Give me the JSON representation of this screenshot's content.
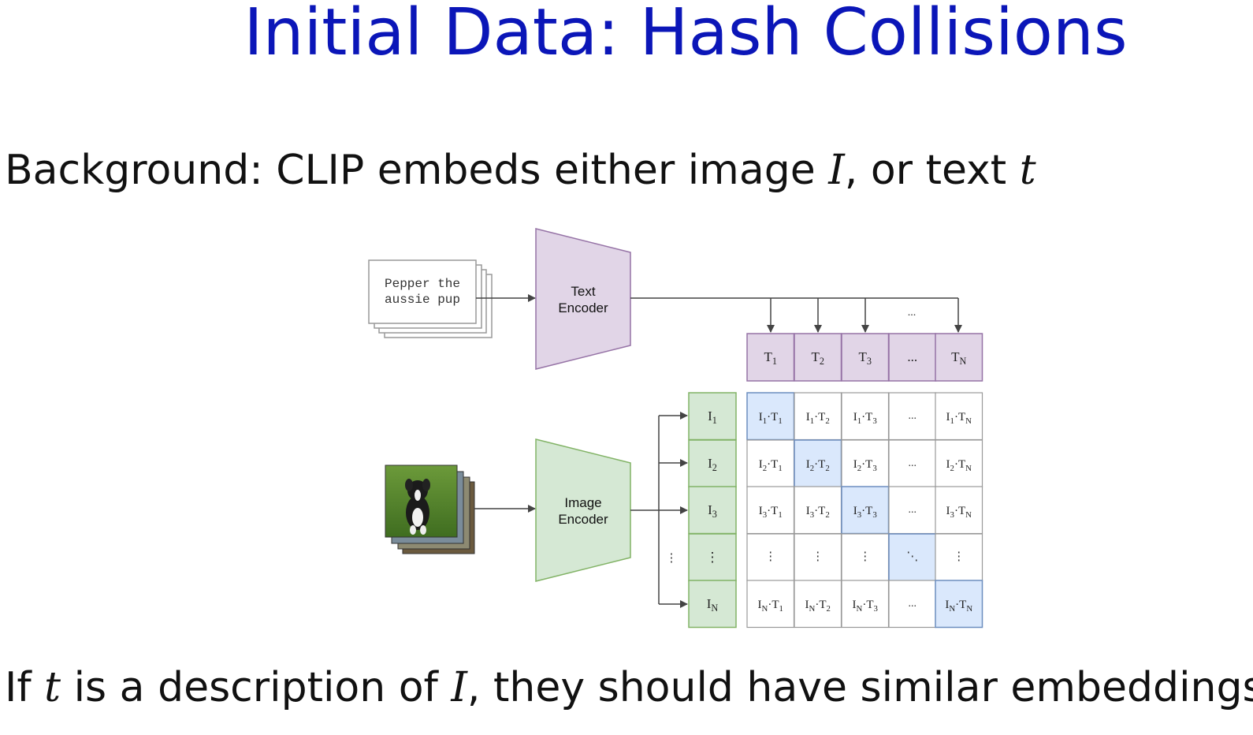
{
  "slide": {
    "title": "Initial Data: Hash Collisions",
    "background": {
      "prefix": "Background: CLIP embeds either image ",
      "var_image": "I",
      "middle": ", or text ",
      "var_text": "t"
    },
    "conclusion": {
      "prefix": "If ",
      "var_text": "t",
      "middle": " is a description of ",
      "var_image": "I",
      "suffix": ", they should have similar embeddings"
    }
  },
  "diagram": {
    "caption_lines": [
      "Pepper the",
      "aussie pup"
    ],
    "text_encoder": [
      "Text",
      "Encoder"
    ],
    "image_encoder": [
      "Image",
      "Encoder"
    ],
    "text_arrows_ellipsis": "...",
    "text_embeddings": [
      {
        "base": "T",
        "sub": "1"
      },
      {
        "base": "T",
        "sub": "2"
      },
      {
        "base": "T",
        "sub": "3"
      },
      {
        "base": "...",
        "sub": ""
      },
      {
        "base": "T",
        "sub": "N"
      }
    ],
    "image_embeddings": [
      {
        "base": "I",
        "sub": "1"
      },
      {
        "base": "I",
        "sub": "2"
      },
      {
        "base": "I",
        "sub": "3"
      },
      {
        "base": "⋮",
        "sub": ""
      },
      {
        "base": "I",
        "sub": "N"
      }
    ],
    "side_ellipsis": "⋮",
    "matrix_ellipsis": "...",
    "matrix_vdots": "⋮",
    "matrix_ddots": "⋱",
    "colors": {
      "text_fill": "#e1d5e7",
      "text_stroke": "#9673a6",
      "image_fill": "#d5e8d4",
      "image_stroke": "#82b366",
      "diag_fill": "#dae8fc",
      "diag_stroke": "#6c8ebf",
      "title": "#0b16b8"
    }
  }
}
